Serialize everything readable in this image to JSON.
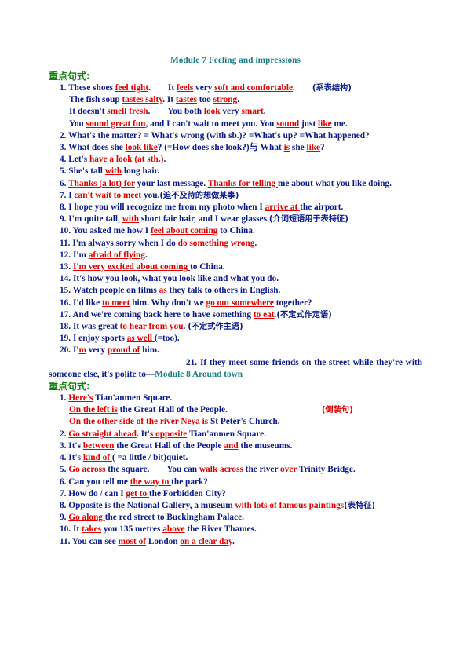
{
  "document": {
    "title": "Module 7 Feeling and impressions",
    "section_header": "重点句式:",
    "second_section_header": "重点句式:",
    "module8_title": "Module 8   Around town"
  },
  "colors": {
    "title": "#1a7c80",
    "section_header": "#128012",
    "body": "#0b1a8c",
    "highlight": "#e00000"
  },
  "module7": {
    "items": [
      {
        "num": "1.",
        "parts": [
          {
            "t": "These shoes ",
            "s": "plain"
          },
          {
            "t": "feel tight",
            "s": "red-u"
          },
          {
            "t": ".",
            "s": "plain"
          },
          {
            "t": "GAP",
            "s": "gap"
          },
          {
            "t": "It ",
            "s": "plain"
          },
          {
            "t": "feels",
            "s": "red-u"
          },
          {
            "t": " very ",
            "s": "plain"
          },
          {
            "t": "soft and comfortable",
            "s": "red-u"
          },
          {
            "t": ".",
            "s": "plain"
          },
          {
            "t": "GAP",
            "s": "gap"
          },
          {
            "t": "(系表结构)",
            "s": "cn"
          }
        ]
      },
      {
        "num": "",
        "indent": 2,
        "parts": [
          {
            "t": "The fish soup ",
            "s": "plain"
          },
          {
            "t": "tastes salty",
            "s": "red-u"
          },
          {
            "t": ". It ",
            "s": "plain"
          },
          {
            "t": "tastes",
            "s": "red-u"
          },
          {
            "t": " too ",
            "s": "plain"
          },
          {
            "t": "strong",
            "s": "red-u"
          },
          {
            "t": ".",
            "s": "plain"
          }
        ]
      },
      {
        "num": "",
        "indent": 2,
        "parts": [
          {
            "t": "It doesn't ",
            "s": "plain"
          },
          {
            "t": "smell fresh",
            "s": "red-u"
          },
          {
            "t": ".",
            "s": "plain"
          },
          {
            "t": "GAP",
            "s": "gap"
          },
          {
            "t": "You both ",
            "s": "plain"
          },
          {
            "t": "look",
            "s": "red-u"
          },
          {
            "t": " very ",
            "s": "plain"
          },
          {
            "t": "smart",
            "s": "red-u"
          },
          {
            "t": ".",
            "s": "plain"
          }
        ]
      },
      {
        "num": "",
        "indent": 2,
        "parts": [
          {
            "t": "You ",
            "s": "plain"
          },
          {
            "t": "sound great fun",
            "s": "red-u"
          },
          {
            "t": ", and I can't wait to meet you. You ",
            "s": "plain"
          },
          {
            "t": "sound",
            "s": "red-u"
          },
          {
            "t": " just ",
            "s": "plain"
          },
          {
            "t": "like",
            "s": "red-u"
          },
          {
            "t": " me.",
            "s": "plain"
          }
        ]
      },
      {
        "num": "2.",
        "justify": true,
        "parts": [
          {
            "t": "What's the matter? = What's wrong (with sb.)? =What's up? =What happened?",
            "s": "plain"
          }
        ]
      },
      {
        "num": "3.",
        "parts": [
          {
            "t": "What does she ",
            "s": "plain"
          },
          {
            "t": "look like",
            "s": "red-u"
          },
          {
            "t": "? (=How does she look?)与 What ",
            "s": "plain"
          },
          {
            "t": "is",
            "s": "red-u"
          },
          {
            "t": " she ",
            "s": "plain"
          },
          {
            "t": "like",
            "s": "red-u"
          },
          {
            "t": "?",
            "s": "plain"
          }
        ]
      },
      {
        "num": "4.",
        "parts": [
          {
            "t": "Let's ",
            "s": "plain"
          },
          {
            "t": "have a look (at sth.)",
            "s": "red-u"
          },
          {
            "t": ".",
            "s": "plain"
          }
        ]
      },
      {
        "num": "5.",
        "parts": [
          {
            "t": "She's tall ",
            "s": "plain"
          },
          {
            "t": "with",
            "s": "red-u"
          },
          {
            "t": " long hair.",
            "s": "plain"
          }
        ]
      },
      {
        "num": "6.",
        "justify": true,
        "parts": [
          {
            "t": "Thanks (a lot) for",
            "s": "red-u"
          },
          {
            "t": " your last message. ",
            "s": "plain"
          },
          {
            "t": "Thanks for telling ",
            "s": "red-u"
          },
          {
            "t": "me about what you like doing.",
            "s": "plain"
          }
        ]
      },
      {
        "num": "7.",
        "parts": [
          {
            "t": "I ",
            "s": "plain"
          },
          {
            "t": "can't wait to meet ",
            "s": "red-u"
          },
          {
            "t": "you.",
            "s": "plain"
          },
          {
            "t": "(迫不及待的想做某事)",
            "s": "cn"
          }
        ]
      },
      {
        "num": "8.",
        "parts": [
          {
            "t": "I hope you will recognize me from my photo when I ",
            "s": "plain"
          },
          {
            "t": "arrive at ",
            "s": "red-u"
          },
          {
            "t": "the airport.",
            "s": "plain"
          }
        ]
      },
      {
        "num": "9.",
        "parts": [
          {
            "t": "I'm quite tall, ",
            "s": "plain"
          },
          {
            "t": "with",
            "s": "red-u"
          },
          {
            "t": " short fair hair, and I wear glasses.",
            "s": "plain"
          },
          {
            "t": "(介词短语用于表特征)",
            "s": "cn"
          }
        ]
      },
      {
        "num": "10.",
        "parts": [
          {
            "t": "You asked me how I ",
            "s": "plain"
          },
          {
            "t": "feel about coming",
            "s": "red-u"
          },
          {
            "t": " to China.",
            "s": "plain"
          }
        ]
      },
      {
        "num": "11.",
        "parts": [
          {
            "t": "I'm always sorry when I do ",
            "s": "plain"
          },
          {
            "t": "do something wrong",
            "s": "red-u"
          },
          {
            "t": ".",
            "s": "plain"
          }
        ]
      },
      {
        "num": "12.",
        "parts": [
          {
            "t": "I'm ",
            "s": "plain"
          },
          {
            "t": "afraid of flying",
            "s": "red-u"
          },
          {
            "t": ".",
            "s": "plain"
          }
        ]
      },
      {
        "num": "13.",
        "parts": [
          {
            "t": "I'm very excited about coming ",
            "s": "red-u"
          },
          {
            "t": "to China.",
            "s": "plain"
          }
        ]
      },
      {
        "num": "14.",
        "parts": [
          {
            "t": "It's how you look, what you look like and what you do.",
            "s": "plain"
          }
        ]
      },
      {
        "num": "15.",
        "parts": [
          {
            "t": "Watch people on films ",
            "s": "plain"
          },
          {
            "t": "as",
            "s": "red-u"
          },
          {
            "t": " they talk to others in English.",
            "s": "plain"
          }
        ]
      },
      {
        "num": "16.",
        "parts": [
          {
            "t": "I'd like ",
            "s": "plain"
          },
          {
            "t": "to meet",
            "s": "red-u"
          },
          {
            "t": " him. Why don't we ",
            "s": "plain"
          },
          {
            "t": "go out somewhere",
            "s": "red-u"
          },
          {
            "t": " together?",
            "s": "plain"
          }
        ]
      },
      {
        "num": "17.",
        "parts": [
          {
            "t": "And we're coming back here to have something ",
            "s": "plain"
          },
          {
            "t": "to eat",
            "s": "red-u"
          },
          {
            "t": ".",
            "s": "plain"
          },
          {
            "t": "(不定式作定语)",
            "s": "cn"
          }
        ]
      },
      {
        "num": "18.",
        "parts": [
          {
            "t": "It was great ",
            "s": "plain"
          },
          {
            "t": "to hear from you",
            "s": "red-u"
          },
          {
            "t": ". ",
            "s": "plain"
          },
          {
            "t": "(不定式作主语)",
            "s": "cn"
          }
        ]
      },
      {
        "num": "19.",
        "parts": [
          {
            "t": "I enjoy sports ",
            "s": "plain"
          },
          {
            "t": "as well ",
            "s": "red-u"
          },
          {
            "t": "(=too).",
            "s": "plain"
          }
        ]
      },
      {
        "num": "20.",
        "parts": [
          {
            "t": "I'",
            "s": "plain"
          },
          {
            "t": "m",
            "s": "red-u"
          },
          {
            "t": " very ",
            "s": "plain"
          },
          {
            "t": "proud of",
            "s": "red-u"
          },
          {
            "t": " him.",
            "s": "plain"
          }
        ]
      }
    ],
    "item21": {
      "num": "21.",
      "text": "If they meet some friends on the street while they're with someone else, it's polite to—"
    }
  },
  "module8": {
    "items": [
      {
        "num": "1.",
        "parts": [
          {
            "t": "Here's",
            "s": "red-u"
          },
          {
            "t": " Tian'anmen Square.",
            "s": "plain"
          }
        ]
      },
      {
        "num": "",
        "indent": 2,
        "parts": [
          {
            "t": "On the left is",
            "s": "red-u"
          },
          {
            "t": " the Great Hall of the People.",
            "s": "plain"
          },
          {
            "t": "GAPL",
            "s": "gapl"
          },
          {
            "t": "(倒装句)",
            "s": "cn-red"
          }
        ]
      },
      {
        "num": "",
        "indent": 2,
        "parts": [
          {
            "t": "On the other side of the river Neya is",
            "s": "red-u"
          },
          {
            "t": " St Peter's Church.",
            "s": "plain"
          }
        ]
      },
      {
        "num": "2.",
        "parts": [
          {
            "t": "Go straight ahead",
            "s": "red-u"
          },
          {
            "t": ". It'",
            "s": "plain"
          },
          {
            "t": "s opposite",
            "s": "red-u"
          },
          {
            "t": " Tian'anmen Square.",
            "s": "plain"
          }
        ]
      },
      {
        "num": "3.",
        "parts": [
          {
            "t": "It's ",
            "s": "plain"
          },
          {
            "t": "between",
            "s": "red-u"
          },
          {
            "t": " the Great Hall of the People ",
            "s": "plain"
          },
          {
            "t": "and",
            "s": "red-u"
          },
          {
            "t": " the museums.",
            "s": "plain"
          }
        ]
      },
      {
        "num": "4.",
        "parts": [
          {
            "t": "It's ",
            "s": "plain"
          },
          {
            "t": "kind of ",
            "s": "red-u"
          },
          {
            "t": "( =a little / bit)quiet.",
            "s": "plain"
          }
        ]
      },
      {
        "num": "5.",
        "parts": [
          {
            "t": "Go across",
            "s": "red-u"
          },
          {
            "t": " the square.",
            "s": "plain"
          },
          {
            "t": "GAP",
            "s": "gap"
          },
          {
            "t": "You can ",
            "s": "plain"
          },
          {
            "t": "walk across",
            "s": "red-u"
          },
          {
            "t": " the river ",
            "s": "plain"
          },
          {
            "t": "over",
            "s": "red-u"
          },
          {
            "t": " Trinity Bridge.",
            "s": "plain"
          }
        ]
      },
      {
        "num": "6.",
        "parts": [
          {
            "t": "Can you tell me ",
            "s": "plain"
          },
          {
            "t": "the way to ",
            "s": "red-u"
          },
          {
            "t": "the park?",
            "s": "plain"
          }
        ]
      },
      {
        "num": "7.",
        "parts": [
          {
            "t": "How do / can I ",
            "s": "plain"
          },
          {
            "t": "get to ",
            "s": "red-u"
          },
          {
            "t": "the Forbidden City?",
            "s": "plain"
          }
        ]
      },
      {
        "num": "8.",
        "justify": true,
        "parts": [
          {
            "t": "Opposite is the National Gallery, a museum ",
            "s": "plain"
          },
          {
            "t": "with lots of famous paintings",
            "s": "red-u"
          },
          {
            "t": "(表特征)",
            "s": "cn"
          }
        ]
      },
      {
        "num": "9.",
        "parts": [
          {
            "t": "Go along ",
            "s": "red-u"
          },
          {
            "t": "the red street to Buckingham Palace.",
            "s": "plain"
          }
        ]
      },
      {
        "num": "10.",
        "parts": [
          {
            "t": "It ",
            "s": "plain"
          },
          {
            "t": "takes",
            "s": "red-u"
          },
          {
            "t": " you 135 metres ",
            "s": "plain"
          },
          {
            "t": "above",
            "s": "red-u"
          },
          {
            "t": " the River Thames.",
            "s": "plain"
          }
        ]
      },
      {
        "num": "11.",
        "parts": [
          {
            "t": "You can see ",
            "s": "plain"
          },
          {
            "t": "most of",
            "s": "red-u"
          },
          {
            "t": " London ",
            "s": "plain"
          },
          {
            "t": "on a clear day",
            "s": "red-u"
          },
          {
            "t": ".",
            "s": "plain"
          }
        ]
      }
    ]
  }
}
